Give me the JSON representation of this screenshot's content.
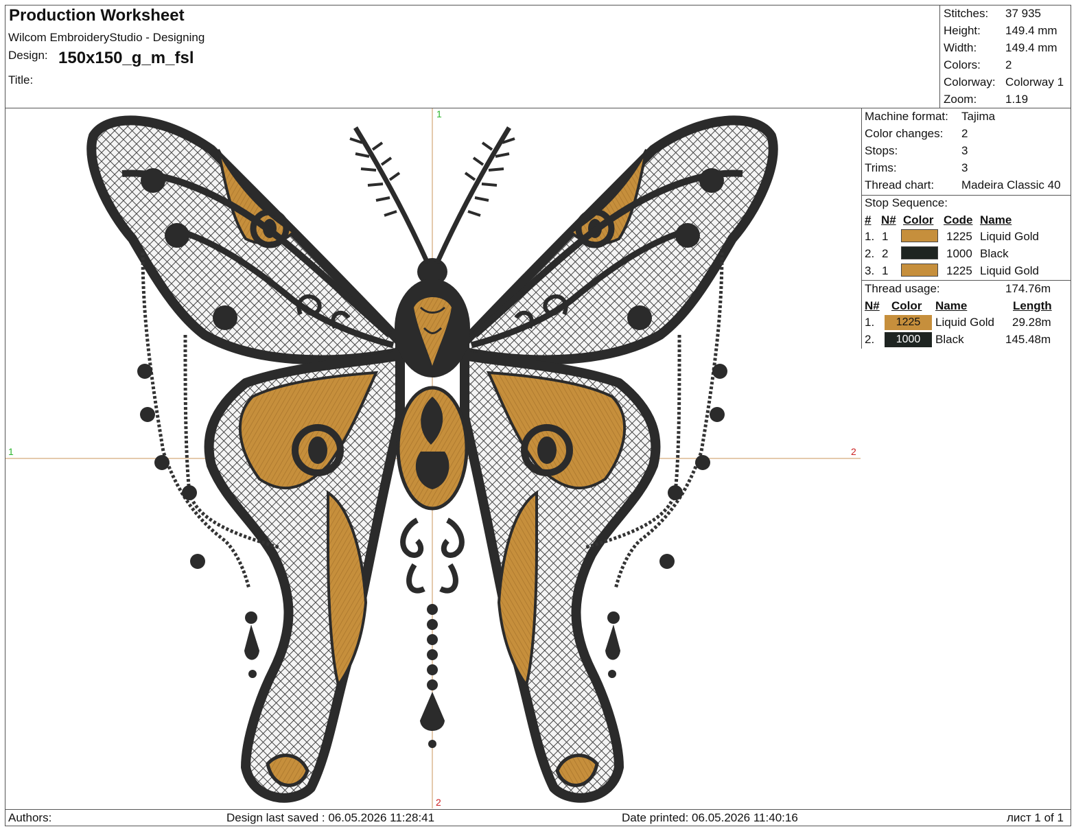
{
  "header": {
    "title": "Production Worksheet",
    "software": "Wilcom EmbroideryStudio - Designing",
    "design_label": "Design:",
    "design_name": "150x150_g_m_fsl",
    "title_label": "Title:"
  },
  "summary": [
    {
      "label": "Stitches:",
      "value": "37 935"
    },
    {
      "label": "Height:",
      "value": "149.4 mm"
    },
    {
      "label": "Width:",
      "value": "149.4 mm"
    },
    {
      "label": "Colors:",
      "value": "2"
    },
    {
      "label": "Colorway:",
      "value": "Colorway 1"
    },
    {
      "label": "Zoom:",
      "value": "1.19"
    }
  ],
  "machine": [
    {
      "label": "Machine format:",
      "value": "Tajima"
    },
    {
      "label": "Color changes:",
      "value": "2"
    },
    {
      "label": "Stops:",
      "value": "3"
    },
    {
      "label": "Trims:",
      "value": "3"
    },
    {
      "label": "Thread chart:",
      "value": "Madeira Classic 40"
    }
  ],
  "stop_sequence": {
    "title": "Stop Sequence:",
    "headers": [
      "#",
      "N#",
      "Color",
      "Code",
      "Name"
    ],
    "rows": [
      {
        "num": "1.",
        "n": "1",
        "color": "#c68f3c",
        "code": "1225",
        "name": "Liquid Gold"
      },
      {
        "num": "2.",
        "n": "2",
        "color": "#1e2421",
        "code": "1000",
        "name": "Black"
      },
      {
        "num": "3.",
        "n": "1",
        "color": "#c68f3c",
        "code": "1225",
        "name": "Liquid Gold"
      }
    ]
  },
  "thread_usage": {
    "title": "Thread usage:",
    "total": "174.76m",
    "headers": [
      "N#",
      "Color",
      "Name",
      "Length"
    ],
    "rows": [
      {
        "n": "1.",
        "code": "1225",
        "color": "#c68f3c",
        "name": "Liquid Gold",
        "length": "29.28m"
      },
      {
        "n": "2.",
        "code": "1000",
        "color": "#1e2421",
        "name": "Black",
        "length": "145.48m"
      }
    ]
  },
  "markers": {
    "top": "1",
    "bottom": "2",
    "left": "1",
    "right": "2"
  },
  "footer": {
    "authors": "Authors:",
    "saved": "Design last saved : 06.05.2026 11:28:41",
    "printed": "Date printed: 06.05.2026 11:40:16",
    "page": "лист 1 of 1"
  },
  "colors": {
    "gold": "#c68f3c",
    "black": "#2b2b2b",
    "guide": "#c9955a"
  }
}
